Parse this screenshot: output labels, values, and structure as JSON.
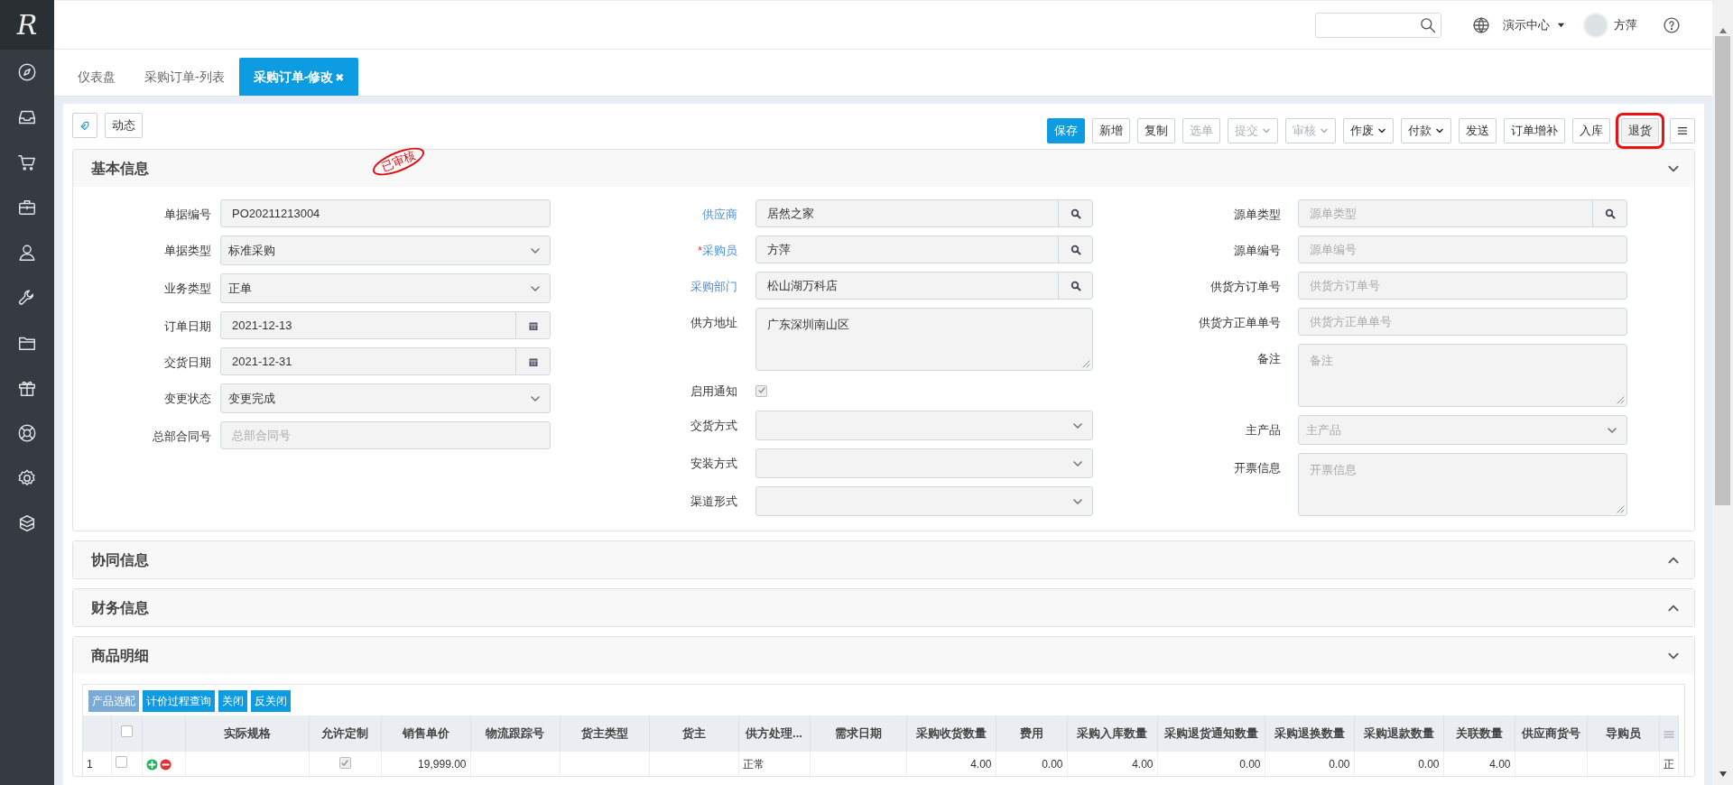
{
  "brand": {
    "logo": "R"
  },
  "header": {
    "org": "演示中心",
    "user": "方萍"
  },
  "tabs": [
    {
      "label": "仪表盘",
      "selected": false
    },
    {
      "label": "采购订单-列表",
      "selected": false
    },
    {
      "label": "采购订单-修改",
      "selected": true,
      "close": "✖"
    }
  ],
  "toolbar_left": [
    {
      "kind": "icon"
    },
    {
      "kind": "button",
      "label": "动态"
    }
  ],
  "actions": [
    {
      "label": "保存",
      "kind": "primary",
      "disabled": false,
      "highlighted": false
    },
    {
      "label": "新增",
      "kind": "plain",
      "disabled": false,
      "highlighted": false
    },
    {
      "label": "复制",
      "kind": "plain",
      "disabled": false,
      "highlighted": false
    },
    {
      "label": "选单",
      "kind": "plain",
      "disabled": true,
      "highlighted": false
    },
    {
      "label": "提交",
      "kind": "dropdown",
      "disabled": true,
      "highlighted": false
    },
    {
      "label": "审核",
      "kind": "dropdown",
      "disabled": true,
      "highlighted": false
    },
    {
      "label": "作废",
      "kind": "dropdown",
      "disabled": false,
      "highlighted": false
    },
    {
      "label": "付款",
      "kind": "dropdown",
      "disabled": false,
      "highlighted": false
    },
    {
      "label": "发送",
      "kind": "plain",
      "disabled": false,
      "highlighted": false
    },
    {
      "label": "订单增补",
      "kind": "plain",
      "disabled": false,
      "highlighted": false
    },
    {
      "label": "入库",
      "kind": "plain",
      "disabled": false,
      "highlighted": false
    },
    {
      "label": "退货",
      "kind": "plain",
      "disabled": false,
      "highlighted": true
    }
  ],
  "sections": [
    {
      "title": "基本信息",
      "expanded": true,
      "stamp": "已审核",
      "form": [
        [
          {
            "label": "单据编号",
            "kind": "text",
            "value": "PO20211213004"
          },
          {
            "label": "单据类型",
            "kind": "select",
            "value": "标准采购"
          },
          {
            "label": "业务类型",
            "kind": "select",
            "value": "正单"
          },
          {
            "label": "订单日期",
            "kind": "date",
            "value": "2021-12-13"
          },
          {
            "label": "交货日期",
            "kind": "date",
            "value": "2021-12-31"
          },
          {
            "label": "变更状态",
            "kind": "select",
            "value": "变更完成"
          },
          {
            "label": "总部合同号",
            "kind": "text",
            "placeholder": "总部合同号"
          }
        ],
        [
          {
            "label": "供应商",
            "kind": "lookup",
            "link": true,
            "value": "居然之家"
          },
          {
            "label": "采购员",
            "kind": "lookup",
            "link": true,
            "required_mark": "*",
            "value": "方萍"
          },
          {
            "label": "采购部门",
            "kind": "lookup",
            "link": true,
            "value": "松山湖万科店"
          },
          {
            "label": "供方地址",
            "kind": "textarea",
            "value": "广东深圳南山区"
          },
          {
            "label": "启用通知",
            "kind": "checkbox",
            "checked": true
          },
          {
            "label": "交货方式",
            "kind": "select"
          },
          {
            "label": "安装方式",
            "kind": "select"
          },
          {
            "label": "渠道形式",
            "kind": "select"
          }
        ],
        [
          {
            "label": "源单类型",
            "kind": "lookup",
            "placeholder": "源单类型"
          },
          {
            "label": "源单编号",
            "kind": "text",
            "placeholder": "源单编号"
          },
          {
            "label": "供货方订单号",
            "kind": "text",
            "placeholder": "供货方订单号"
          },
          {
            "label": "供货方正单单号",
            "kind": "text",
            "placeholder": "供货方正单单号"
          },
          {
            "label": "备注",
            "kind": "textarea",
            "placeholder": "备注"
          },
          {
            "label": "主产品",
            "kind": "select",
            "placeholder": "主产品"
          },
          {
            "label": "开票信息",
            "kind": "textarea",
            "placeholder": "开票信息"
          }
        ]
      ]
    },
    {
      "title": "协同信息",
      "expanded": false
    },
    {
      "title": "财务信息",
      "expanded": false
    },
    {
      "title": "商品明细",
      "expanded": true,
      "table": {
        "buttons": [
          {
            "label": "产品选配",
            "disabled": true
          },
          {
            "label": "计价过程查询",
            "disabled": false
          },
          {
            "label": "关闭",
            "disabled": false
          },
          {
            "label": "反关闭",
            "disabled": false
          }
        ],
        "all_selected": false,
        "columns": [
          "实际规格",
          "允许定制",
          "销售单价",
          "物流跟踪号",
          "货主类型",
          "货主",
          "供方处理...",
          "需求日期",
          "采购收货数量",
          "费用",
          "采购入库数量",
          "采购退货通知数量",
          "采购退换数量",
          "采购退款数量",
          "关联数量",
          "供应商货号",
          "导购员"
        ],
        "rows": [
          {
            "index": "1",
            "selected": false,
            "cells": [
              {},
              {
                "kind": "checkbox",
                "checked": true
              },
              {
                "text": "19,999.00"
              },
              {},
              {},
              {},
              {
                "text": "正常"
              },
              {},
              {
                "text": "4.00"
              },
              {
                "text": "0.00"
              },
              {
                "text": "4.00"
              },
              {
                "text": "0.00"
              },
              {
                "text": "0.00"
              },
              {
                "text": "0.00"
              },
              {
                "text": "4.00"
              },
              {},
              {},
              {
                "text": "正"
              }
            ]
          }
        ]
      }
    }
  ]
}
